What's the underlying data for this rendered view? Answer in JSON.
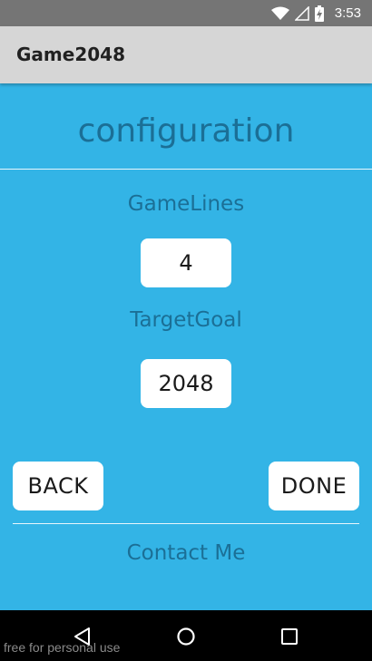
{
  "status_bar": {
    "time": "3:53",
    "icons": [
      "wifi-icon",
      "signal-icon",
      "battery-charging-icon"
    ]
  },
  "app_bar": {
    "title": "Game2048"
  },
  "config": {
    "title": "configuration",
    "game_lines_label": "GameLines",
    "game_lines_value": "4",
    "target_goal_label": "TargetGoal",
    "target_goal_value": "2048"
  },
  "actions": {
    "back_label": "BACK",
    "done_label": "DONE"
  },
  "footer": {
    "contact_label": "Contact Me"
  },
  "nav_bar": {
    "icons": [
      "back-icon",
      "home-icon",
      "recents-icon"
    ]
  },
  "watermark": "free for personal use",
  "colors": {
    "background": "#33b4e6",
    "accent_text": "#1b6f96",
    "status_bar": "#757575",
    "app_bar": "#d6d6d6"
  }
}
